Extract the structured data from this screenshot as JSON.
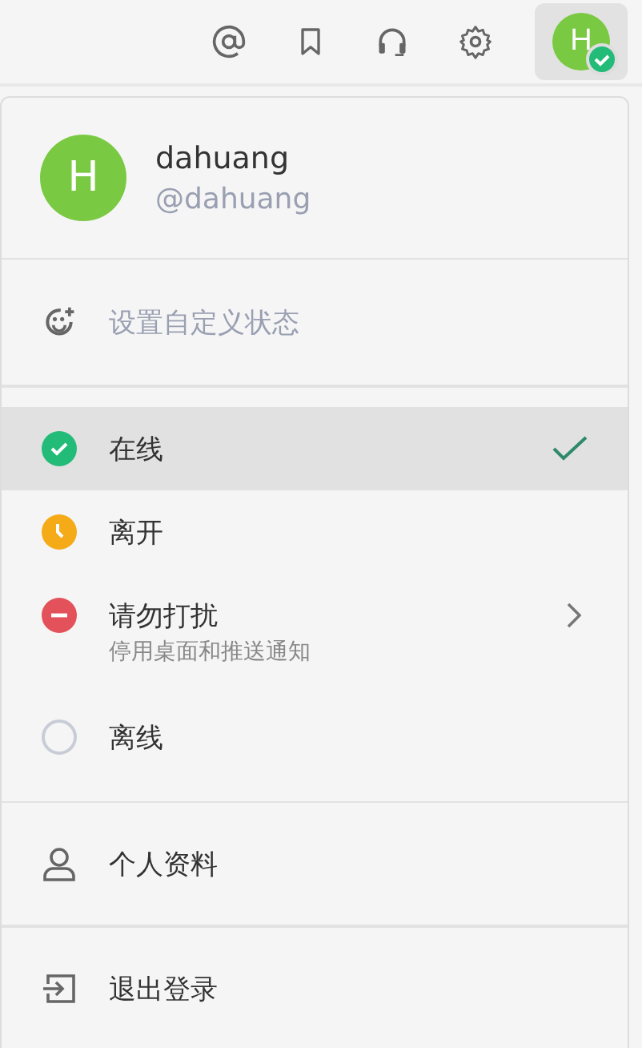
{
  "toolbar": {
    "avatar_letter": "H",
    "online": true
  },
  "user": {
    "avatar_letter": "H",
    "name": "dahuang",
    "handle": "@dahuang"
  },
  "custom_status": {
    "label": "设置自定义状态"
  },
  "statuses": [
    {
      "kind": "online",
      "label": "在线",
      "selected": true
    },
    {
      "kind": "away",
      "label": "离开",
      "selected": false
    },
    {
      "kind": "dnd",
      "label": "请勿打扰",
      "description": "停用桌面和推送通知",
      "submenu": true,
      "selected": false
    },
    {
      "kind": "offline",
      "label": "离线",
      "selected": false
    }
  ],
  "actions": [
    {
      "kind": "profile",
      "label": "个人资料"
    },
    {
      "kind": "logout",
      "label": "退出登录"
    }
  ]
}
